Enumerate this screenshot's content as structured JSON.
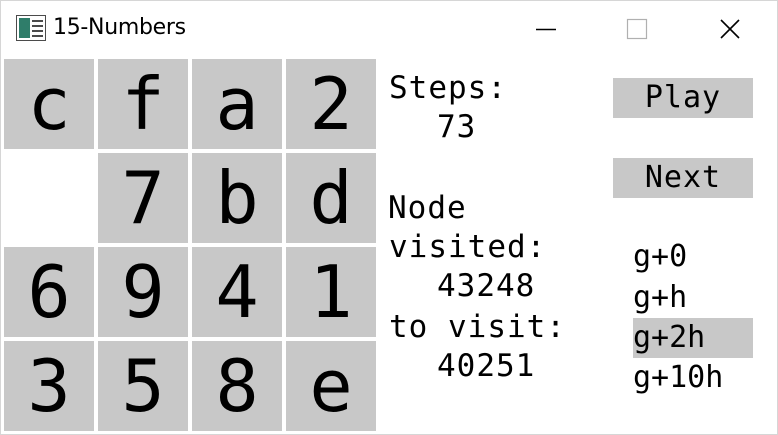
{
  "window": {
    "title": "15-Numbers",
    "app_icon": "window-app-icon",
    "controls": [
      "minimize-icon",
      "maximize-icon",
      "close-icon"
    ]
  },
  "board": {
    "rows": [
      [
        "c",
        "f",
        "a",
        "2"
      ],
      [
        "",
        "7",
        "b",
        "d"
      ],
      [
        "6",
        "9",
        "4",
        "1"
      ],
      [
        "3",
        "5",
        "8",
        "e"
      ]
    ],
    "tile_color": "#c8c8c8",
    "empty_color": "#ffffff"
  },
  "stats": {
    "steps_label": "Steps:",
    "steps_value": "73",
    "node_label": "Node",
    "visited_label": "visited:",
    "visited_value": "43248",
    "to_visit_label": "to visit:",
    "to_visit_value": "40251"
  },
  "controls": {
    "play_label": "Play",
    "next_label": "Next"
  },
  "heuristics": {
    "options": [
      "g+0",
      "g+h",
      "g+2h",
      "g+10h"
    ],
    "selected": "g+2h"
  }
}
